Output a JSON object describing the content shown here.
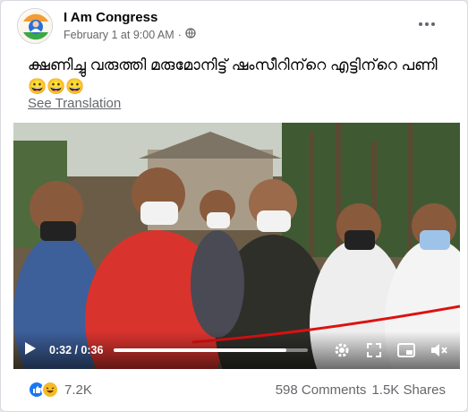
{
  "post": {
    "page_name": "I Am Congress",
    "date": "February 1 at 9:00 AM",
    "separator": "·",
    "text": "ക്ഷണിച്ചു വരുത്തി മരുമോനിട്ട് ഷംസീറിന്‌റെ എട്ടിന്‌റെ പണി 😀😀😀",
    "see_translation": "See Translation"
  },
  "video": {
    "current_time": "0:32",
    "duration": "0:36",
    "time_display": "0:32 / 0:36",
    "progress": 0.89,
    "icons": [
      "play-icon",
      "settings-icon",
      "fullscreen-icon",
      "picture-in-picture-icon",
      "mute-icon"
    ]
  },
  "stats": {
    "reactions_count": "7.2K",
    "reaction_icons": [
      "like-icon",
      "haha-icon"
    ],
    "comments": "598 Comments",
    "shares": "1.5K Shares"
  },
  "colors": {
    "accent": "#1877f2",
    "secondary_text": "#65676b",
    "haha": "#f7b928"
  }
}
